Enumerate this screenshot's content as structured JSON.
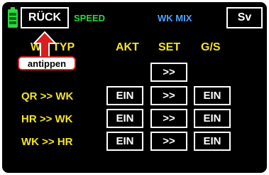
{
  "header": {
    "back_label": "RÜCK",
    "mode_label": "SPEED",
    "screen_title": "WK MIX",
    "save_label": "Sv"
  },
  "columns": {
    "type": "WK TYP",
    "akt": "AKT",
    "set": "SET",
    "gs": "G/S"
  },
  "rows": [
    {
      "label": "",
      "akt": "",
      "set": ">>",
      "gs": ""
    },
    {
      "label": "QR >> WK",
      "akt": "EIN",
      "set": ">>",
      "gs": "EIN"
    },
    {
      "label": "HR >> WK",
      "akt": "EIN",
      "set": ">>",
      "gs": "EIN"
    },
    {
      "label": "WK >> HR",
      "akt": "EIN",
      "set": ">>",
      "gs": "EIN"
    }
  ],
  "callout": {
    "text": "antippen"
  },
  "colors": {
    "background": "#000000",
    "label": "#f2e32b",
    "mode": "#2fd63f",
    "title": "#4da3ff",
    "callout_border": "#d81e1e"
  }
}
